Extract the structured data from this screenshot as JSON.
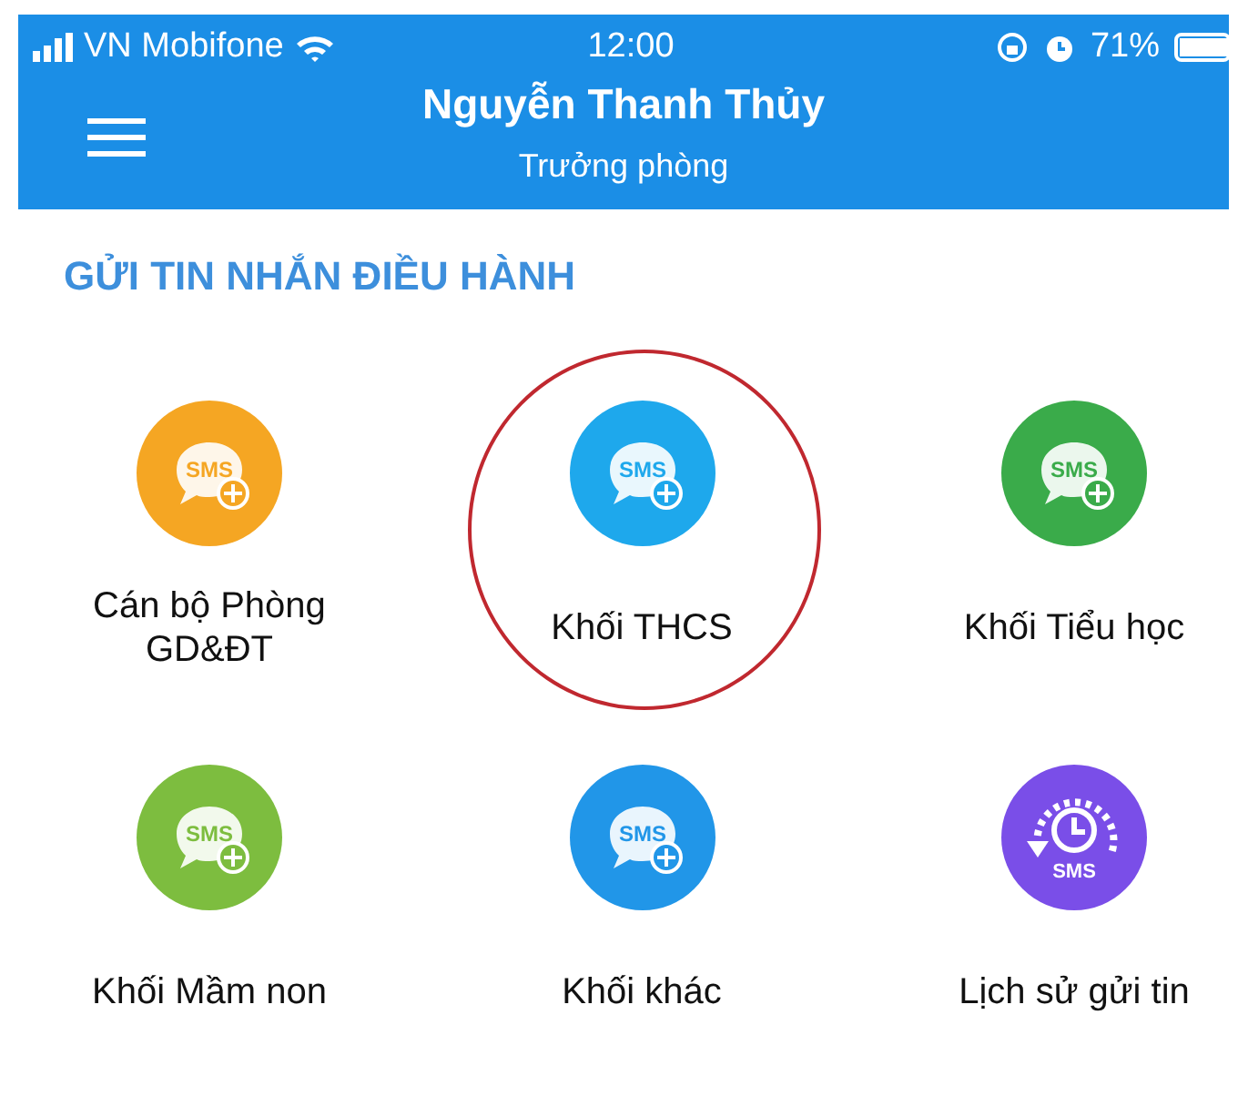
{
  "status_bar": {
    "carrier": "VN Mobifone",
    "time": "12:00",
    "battery": "71%"
  },
  "header": {
    "title": "Nguyễn Thanh Thủy",
    "subtitle": "Trưởng phòng"
  },
  "section": {
    "title": "GỬI TIN NHẮN ĐIỀU HÀNH"
  },
  "tiles": [
    {
      "kind": "sms_add",
      "icon_text": "SMS",
      "color": "#f5a623",
      "label": "Cán bộ Phòng GD&ĐT",
      "circled": false
    },
    {
      "kind": "sms_add",
      "icon_text": "SMS",
      "color": "#1ea8ec",
      "label": "Khối THCS",
      "circled": true
    },
    {
      "kind": "sms_add",
      "icon_text": "SMS",
      "color": "#3aab4a",
      "label": "Khối Tiểu học",
      "circled": false
    },
    {
      "kind": "sms_add",
      "icon_text": "SMS",
      "color": "#7dbd3f",
      "label": "Khối Mầm non",
      "circled": false
    },
    {
      "kind": "sms_add",
      "icon_text": "SMS",
      "color": "#2196e8",
      "label": "Khối khác",
      "circled": false
    },
    {
      "kind": "history",
      "icon_text": "SMS",
      "color": "#7a4ee8",
      "label": "Lịch sử gửi tin",
      "circled": false
    }
  ]
}
